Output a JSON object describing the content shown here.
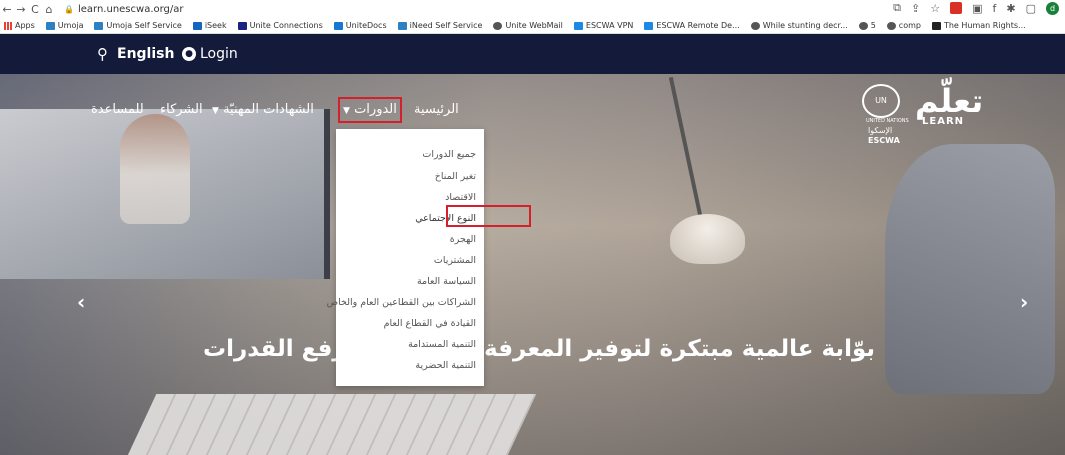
{
  "browser": {
    "url": "learn.unescwa.org/ar",
    "back": "←",
    "forward": "→",
    "reload": "C",
    "home": "⌂"
  },
  "bookmarks": [
    {
      "label": "Apps",
      "color": "#e94235"
    },
    {
      "label": "Umoja",
      "color": "#2f80c0"
    },
    {
      "label": "Umoja Self Service",
      "color": "#2f80c0"
    },
    {
      "label": "iSeek",
      "color": "#1565c0"
    },
    {
      "label": "Unite Connections",
      "color": "#1a237e"
    },
    {
      "label": "UniteDocs",
      "color": "#1976d2"
    },
    {
      "label": "iNeed Self Service",
      "color": "#2f80c0"
    },
    {
      "label": "Unite WebMail",
      "color": "#555555"
    },
    {
      "label": "ESCWA VPN",
      "color": "#1e88e5"
    },
    {
      "label": "ESCWA Remote De...",
      "color": "#1e88e5"
    },
    {
      "label": "While stunting decr...",
      "color": "#555555"
    },
    {
      "label": "5",
      "color": "#555555"
    },
    {
      "label": "comp",
      "color": "#555555"
    },
    {
      "label": "The Human Rights...",
      "color": "#222222"
    }
  ],
  "header": {
    "language": "English",
    "login": "Login"
  },
  "nav": {
    "home": "الرئيسية",
    "courses": "الدورات",
    "certificates": "الشهادات المهنيّة",
    "partners": "الشركاء",
    "help": "للمساعدة"
  },
  "logo": {
    "arabic": "تعلّم",
    "english": "LEARN",
    "org_ar": "الإسكوا",
    "org_en": "ESCWA",
    "un": "UNITED NATIONS"
  },
  "dropdown": [
    "جميع الدورات",
    "تغير المناخ",
    "الاقتصاد",
    "النوع الاجتماعي",
    "الهجرة",
    "المشتريات",
    "السياسة العامة",
    "الشراكات بين القطاعين العام والخاص",
    "القيادة في القطاع العام",
    "التنمية المستدامة",
    "التنمية الحضرية"
  ],
  "headline": {
    "left": "رفع القدرات",
    "right": "بوّابة عالمية مبتكرة لتوفير المعرفة"
  },
  "colors": {
    "header_bg": "#141a3a",
    "highlight": "#d3202a"
  }
}
